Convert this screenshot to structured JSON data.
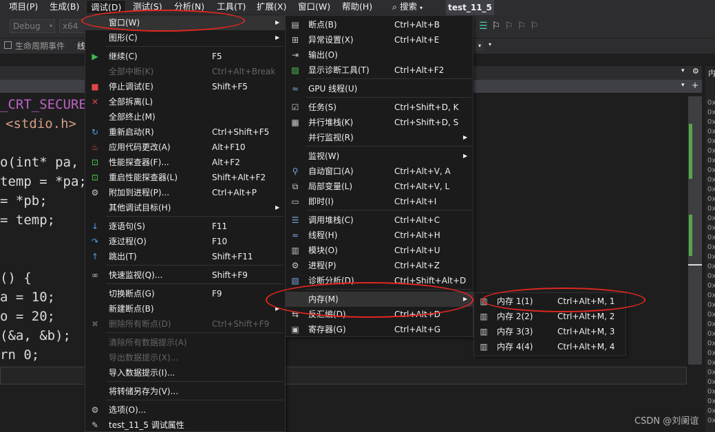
{
  "menubar": {
    "items": [
      "项目(P)",
      "生成(B)",
      "调试(D)",
      "测试(S)",
      "分析(N)",
      "工具(T)",
      "扩展(X)",
      "窗口(W)",
      "帮助(H)"
    ],
    "search": "搜索",
    "title": "test_11_5"
  },
  "toolbar": {
    "config": "Debug",
    "platform": "x64",
    "lifecycle": "生命周期事件",
    "thread_prefix": "线"
  },
  "code_lines": [
    "_CRT_SECURE_",
    "<stdio.h>",
    "o(int* pa,",
    "temp = *pa;",
    "= *pb;",
    "= temp;",
    "() {",
    "a = 10;",
    "o = 20;",
    "(&a, &b);",
    "rn 0;"
  ],
  "debug_menu": {
    "items": [
      {
        "label": "窗口(W)",
        "shortcut": "",
        "icon": "",
        "submenu": true
      },
      {
        "label": "图形(C)",
        "shortcut": "",
        "icon": "",
        "submenu": true
      },
      {
        "label": "继续(C)",
        "shortcut": "F5",
        "icon": "play-icon"
      },
      {
        "label": "全部中断(K)",
        "shortcut": "Ctrl+Alt+Break",
        "icon": "",
        "disabled": true
      },
      {
        "label": "停止调试(E)",
        "shortcut": "Shift+F5",
        "icon": "stop-icon"
      },
      {
        "label": "全部拆离(L)",
        "shortcut": "",
        "icon": "close-icon"
      },
      {
        "label": "全部终止(M)",
        "shortcut": "",
        "icon": ""
      },
      {
        "label": "重新启动(R)",
        "shortcut": "Ctrl+Shift+F5",
        "icon": "restart-icon"
      },
      {
        "label": "应用代码更改(A)",
        "shortcut": "Alt+F10",
        "icon": "hot-reload-icon"
      },
      {
        "label": "性能探查器(F)...",
        "shortcut": "Alt+F2",
        "icon": "profiler-icon"
      },
      {
        "label": "重启性能探查器(L)",
        "shortcut": "Shift+Alt+F2",
        "icon": "profiler-icon"
      },
      {
        "label": "附加到进程(P)...",
        "shortcut": "Ctrl+Alt+P",
        "icon": "gears-icon"
      },
      {
        "label": "其他调试目标(H)",
        "shortcut": "",
        "icon": "",
        "submenu": true
      },
      {
        "label": "逐语句(S)",
        "shortcut": "F11",
        "icon": "step-into-icon"
      },
      {
        "label": "逐过程(O)",
        "shortcut": "F10",
        "icon": "step-over-icon"
      },
      {
        "label": "跳出(T)",
        "shortcut": "Shift+F11",
        "icon": "step-out-icon"
      },
      {
        "label": "快速监视(Q)...",
        "shortcut": "Shift+F9",
        "icon": "glasses-icon"
      },
      {
        "label": "切换断点(G)",
        "shortcut": "F9",
        "icon": ""
      },
      {
        "label": "新建断点(B)",
        "shortcut": "",
        "icon": "",
        "submenu": true
      },
      {
        "label": "删除所有断点(D)",
        "shortcut": "Ctrl+Shift+F9",
        "icon": "delete-breakpoints-icon",
        "disabled": true
      },
      {
        "label": "清除所有数据提示(A)",
        "shortcut": "",
        "icon": "",
        "disabled": true
      },
      {
        "label": "导出数据提示(X)...",
        "shortcut": "",
        "icon": "",
        "disabled": true
      },
      {
        "label": "导入数据提示(I)...",
        "shortcut": "",
        "icon": ""
      },
      {
        "label": "将转储另存为(V)...",
        "shortcut": "",
        "icon": ""
      },
      {
        "label": "选项(O)...",
        "shortcut": "",
        "icon": "gear-icon"
      },
      {
        "label": "test_11_5 调试属性",
        "shortcut": "",
        "icon": "wrench-icon"
      }
    ]
  },
  "window_menu": {
    "items": [
      {
        "label": "断点(B)",
        "shortcut": "Ctrl+Alt+B",
        "icon": "breakpoints-icon"
      },
      {
        "label": "异常设置(X)",
        "shortcut": "Ctrl+Alt+E",
        "icon": "exception-icon"
      },
      {
        "label": "输出(O)",
        "shortcut": "",
        "icon": "output-icon"
      },
      {
        "label": "显示诊断工具(T)",
        "shortcut": "Ctrl+Alt+F2",
        "icon": "diagnostics-icon"
      },
      {
        "label": "GPU 线程(U)",
        "shortcut": "",
        "icon": "gpu-threads-icon"
      },
      {
        "label": "任务(S)",
        "shortcut": "Ctrl+Shift+D, K",
        "icon": "tasks-icon"
      },
      {
        "label": "并行堆栈(K)",
        "shortcut": "Ctrl+Shift+D, S",
        "icon": "parallel-stacks-icon"
      },
      {
        "label": "并行监视(R)",
        "shortcut": "",
        "icon": "",
        "submenu": true
      },
      {
        "label": "监视(W)",
        "shortcut": "",
        "icon": "",
        "submenu": true
      },
      {
        "label": "自动窗口(A)",
        "shortcut": "Ctrl+Alt+V, A",
        "icon": "autos-icon"
      },
      {
        "label": "局部变量(L)",
        "shortcut": "Ctrl+Alt+V, L",
        "icon": "locals-icon"
      },
      {
        "label": "即时(I)",
        "shortcut": "Ctrl+Alt+I",
        "icon": "immediate-icon"
      },
      {
        "label": "调用堆栈(C)",
        "shortcut": "Ctrl+Alt+C",
        "icon": "call-stack-icon"
      },
      {
        "label": "线程(H)",
        "shortcut": "Ctrl+Alt+H",
        "icon": "threads-icon"
      },
      {
        "label": "模块(O)",
        "shortcut": "Ctrl+Alt+U",
        "icon": "modules-icon"
      },
      {
        "label": "进程(P)",
        "shortcut": "Ctrl+Alt+Z",
        "icon": "processes-icon"
      },
      {
        "label": "诊断分析(D)",
        "shortcut": "Ctrl+Shift+Alt+D",
        "icon": "diagnostic-analysis-icon"
      },
      {
        "label": "内存(M)",
        "shortcut": "",
        "icon": "",
        "submenu": true
      },
      {
        "label": "反汇编(D)",
        "shortcut": "Ctrl+Alt+D",
        "icon": "disassembly-icon"
      },
      {
        "label": "寄存器(G)",
        "shortcut": "Ctrl+Alt+G",
        "icon": "registers-icon"
      }
    ]
  },
  "memory_menu": {
    "items": [
      {
        "label": "内存 1(1)",
        "shortcut": "Ctrl+Alt+M, 1"
      },
      {
        "label": "内存 2(2)",
        "shortcut": "Ctrl+Alt+M, 2"
      },
      {
        "label": "内存 3(3)",
        "shortcut": "Ctrl+Alt+M, 3"
      },
      {
        "label": "内存 4(4)",
        "shortcut": "Ctrl+Alt+M, 4"
      }
    ]
  },
  "right_panel": {
    "title": "内",
    "row_prefix": "0x"
  },
  "watermark": "CSDN @刘阑谊"
}
